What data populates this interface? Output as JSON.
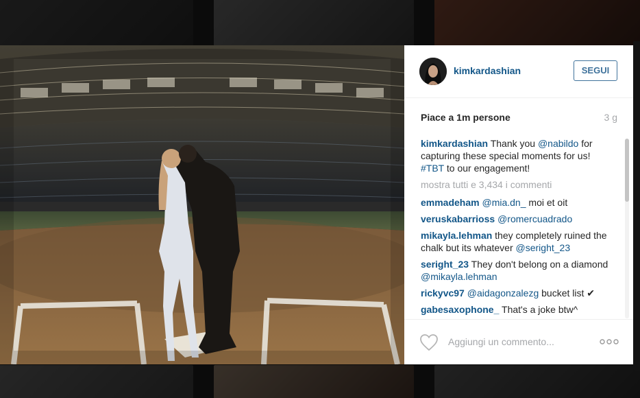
{
  "post": {
    "username": "kimkardashian",
    "follow_label": "SEGUI",
    "likes": "Piace a 1m persone",
    "time_ago": "3 g"
  },
  "caption": {
    "user": "kimkardashian",
    "text_1": " Thank you ",
    "mention_1": "@nabildo",
    "text_2": " for capturing these special moments for us! ",
    "hashtag": "#TBT",
    "text_3": " to our engagement!"
  },
  "load_more": "mostra tutti e 3,434 i commenti",
  "comments": [
    {
      "user": "emmadeham",
      "mention": "@mia.dn_",
      "after": " moi et oit"
    },
    {
      "user": "veruskabarrioss",
      "mention": "@romercuadrado",
      "after": ""
    },
    {
      "user": "mikayla.lehman",
      "before": " they completely ruined the chalk but its whatever ",
      "mention": "@seright_23"
    },
    {
      "user": "seright_23",
      "before": " They don't belong on a diamond ",
      "mention": "@mikayla.lehman"
    },
    {
      "user": "rickyvc97",
      "mention": "@aidagonzalezg",
      "after": " bucket list ✔"
    },
    {
      "user": "gabesaxophone_",
      "before": " That's a joke btw^"
    }
  ],
  "footer": {
    "comment_placeholder": "Aggiungi un commento..."
  },
  "icons": {
    "like": "heart-icon",
    "options": "more-options-icon"
  },
  "colors": {
    "username": "#125688",
    "follow_button": "#3f729b",
    "muted": "#a5a7aa"
  }
}
